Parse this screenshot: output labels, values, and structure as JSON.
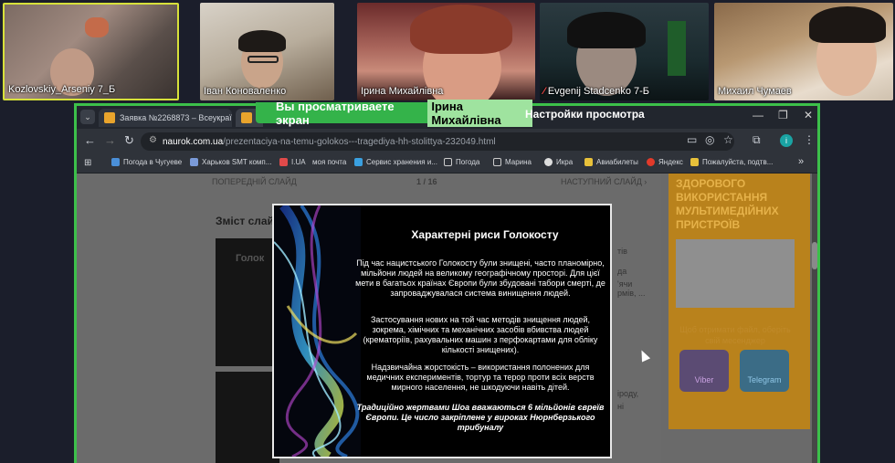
{
  "participants": [
    {
      "name": "Kozlovskiy_Arseniy 7_Б",
      "muted": false
    },
    {
      "name": "Іван Коноваленко",
      "muted": false
    },
    {
      "name": "Ірина Михайлівна",
      "muted": false
    },
    {
      "name": "Evgenij Stadcenko 7-Б",
      "muted": true
    },
    {
      "name": "Михаил Чумаев",
      "muted": false
    }
  ],
  "share": {
    "banner_text": "Вы просматриваете экран",
    "presenter": "Ірина Михайлівна",
    "settings_label": "Настройки просмотра"
  },
  "browser": {
    "tabs": [
      {
        "title": "Заявка №2268873 – Всеукраїнс"
      },
      {
        "title": "x"
      }
    ],
    "url_host": "naurok.com.ua",
    "url_path": "/prezentaciya-na-temu-golokos---tragediya-hh-stolittya-232049.html",
    "bookmarks": [
      "Погода в Чугуеве",
      "Харьков SMT комп...",
      "I.UA",
      "моя почта",
      "Сервис хранения и...",
      "Погода",
      "Марина",
      "Икра",
      "Авиабилеты",
      "Яндекс",
      "Пожалуйста, подтв...",
      "»"
    ]
  },
  "page": {
    "prev_label": "ПОПЕРЕДНІЙ СЛАЙД",
    "counter": "1 / 16",
    "next_label": "НАСТУПНИЙ СЛАЙД ›",
    "content_heading": "Зміст слайд",
    "thumb_title": "Голок",
    "side_fragments": [
      "да",
      "тів",
      "'ячи",
      "рмів, ...",
      "іроду,",
      "ні"
    ],
    "sidebar": {
      "promo": "ЗДОРОВОГО ВИКОРИСТАННЯ МУЛЬТИМЕДІЙНИХ ПРИСТРОЇВ",
      "ask": "Щоб отримати файл, оберіть свій месенджер",
      "viber": "Viber",
      "telegram": "Telegram"
    }
  },
  "slide": {
    "title": "Характерні риси Голокосту",
    "p1": "Під час нацистського Голокосту були знищені, часто планомірно, мільйони людей на великому географічному просторі. Для цієї мети в багатьох країнах Європи були збудовані табори смерті, де запроваджувалася система винищення людей.",
    "p2": "Застосування нових на той час методів знищення людей, зокрема, хімічних та механічних засобів вбивства людей (крематоріїв, рахувальних машин з перфокартами для обліку кількості знищених).",
    "p3": "Надзвичайна жорстокість – використання полонених для медичних експериментів, тортур та терор проти всіх верств мирного населення, не шкодуючи навіть дітей.",
    "p4": "Традиційно жертвами Шоа вважаються 6 мільйонів євреїв Європи. Це число закріплене у вироках Нюрнберзького трибуналу"
  }
}
